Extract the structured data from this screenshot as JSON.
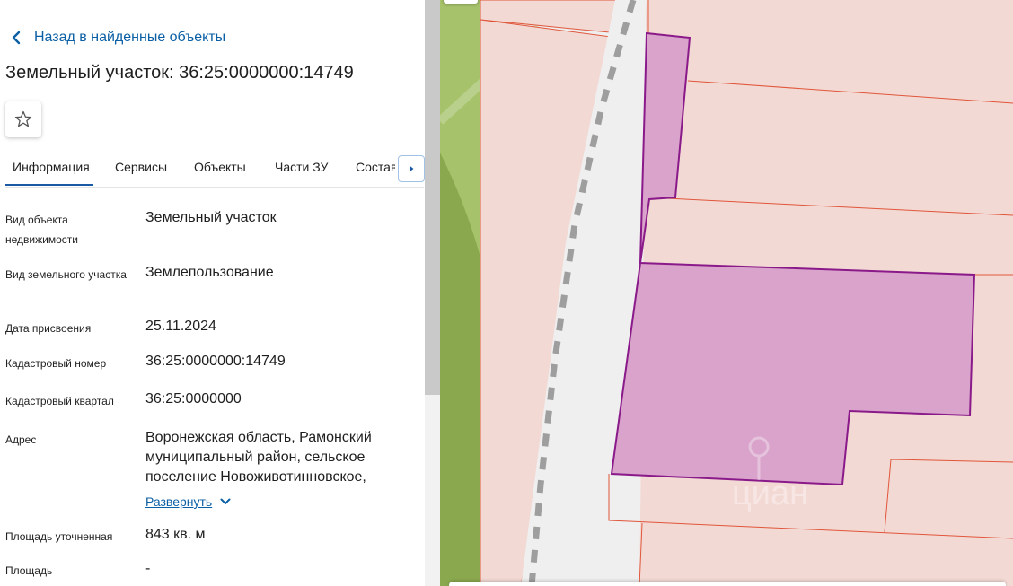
{
  "header": {
    "back_label": "Назад в найденные объекты",
    "title": "Земельный участок: 36:25:0000000:14749"
  },
  "tabs": [
    {
      "label": "Информация",
      "active": true
    },
    {
      "label": "Сервисы"
    },
    {
      "label": "Объекты"
    },
    {
      "label": "Части ЗУ"
    },
    {
      "label": "Состав"
    }
  ],
  "info": {
    "object_type": {
      "label": "Вид объекта недвижимости",
      "value": "Земельный участок"
    },
    "land_type": {
      "label": "Вид земельного участка",
      "value": "Землепользование"
    },
    "assign_date": {
      "label": "Дата присвоения",
      "value": "25.11.2024"
    },
    "cadastral_number": {
      "label": "Кадастровый номер",
      "value": "36:25:0000000:14749"
    },
    "cadastral_quarter": {
      "label": "Кадастровый квартал",
      "value": "36:25:0000000"
    },
    "address": {
      "label": "Адрес",
      "value": "Воронежская область, Рамонский муниципальный район, сельское поселение Новоживотинновское,",
      "expand_label": "Развернуть"
    },
    "area_specified": {
      "label": "Площадь уточненная",
      "value": "843 кв. м"
    },
    "area": {
      "label": "Площадь",
      "value": "-"
    }
  },
  "map": {
    "watermark_text": "циан",
    "colors": {
      "parcel_fill": "#f3d9d4",
      "parcel_border": "#e0563a",
      "selected_fill": "#d9a3cb",
      "selected_border": "#8a1a8a",
      "road": "#efefef",
      "greenery_light": "#a6c26a",
      "greenery_dark": "#8aa94e"
    }
  },
  "accent_color": "#0b5fa5"
}
